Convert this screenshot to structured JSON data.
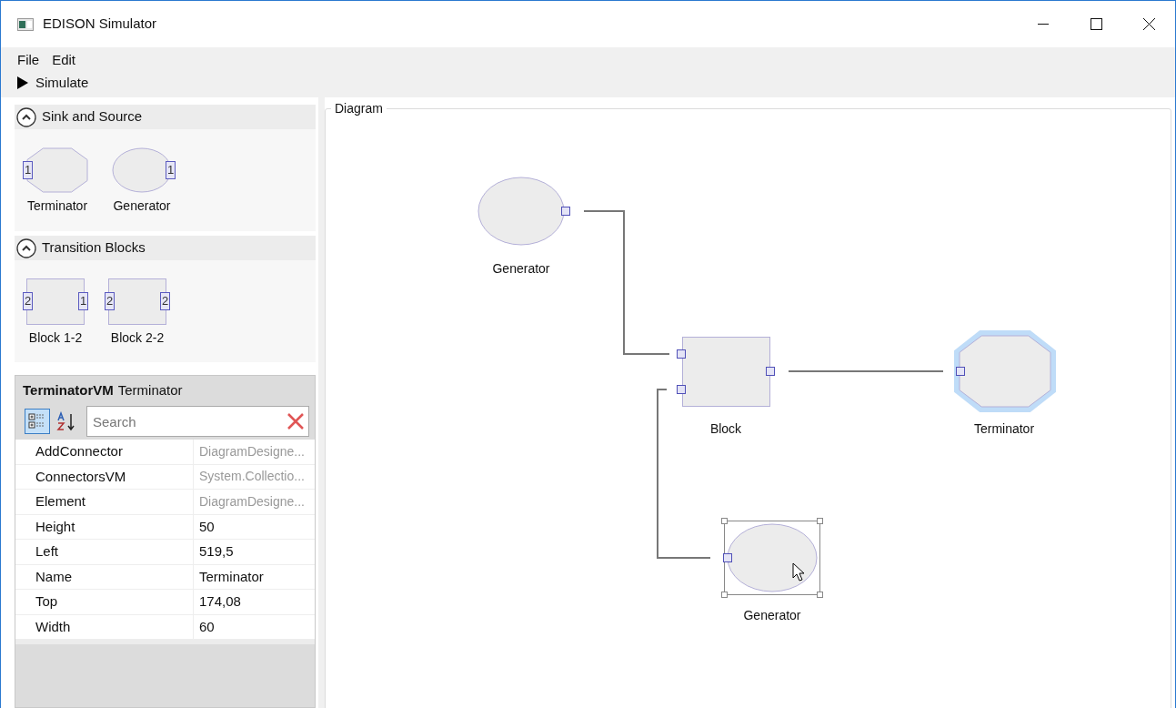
{
  "window": {
    "title": "EDISON Simulator"
  },
  "menu": [
    "File",
    "Edit"
  ],
  "toolbar": {
    "simulate": "Simulate"
  },
  "toolbox": [
    {
      "title": "Sink and Source",
      "expanded": true,
      "items": [
        {
          "kind": "octagon",
          "label": "Terminator",
          "left_ports": [
            "1"
          ]
        },
        {
          "kind": "ellipse",
          "label": "Generator",
          "right_ports": [
            "1"
          ]
        }
      ]
    },
    {
      "title": "Transition Blocks",
      "expanded": true,
      "items": [
        {
          "kind": "rect",
          "label": "Block 1-2",
          "left_ports": [
            "2"
          ],
          "right_ports": [
            "1"
          ]
        },
        {
          "kind": "rect",
          "label": "Block 2-2",
          "left_ports": [
            "2"
          ],
          "right_ports": [
            "2"
          ]
        }
      ]
    }
  ],
  "properties": {
    "type_name": "TerminatorVM",
    "object_name": "Terminator",
    "sort_buttons": [
      {
        "kind": "categorized",
        "selected": true
      },
      {
        "kind": "alphabetical",
        "selected": false
      }
    ],
    "search": {
      "placeholder": "Search"
    },
    "rows": [
      {
        "name": "AddConnector",
        "value": "DiagramDesigne...",
        "readonly": true
      },
      {
        "name": "ConnectorsVM",
        "value": "System.Collectio...",
        "readonly": true
      },
      {
        "name": "Element",
        "value": "DiagramDesigne...",
        "readonly": true
      },
      {
        "name": "Height",
        "value": "50",
        "readonly": false
      },
      {
        "name": "Left",
        "value": "519,5",
        "readonly": false
      },
      {
        "name": "Name",
        "value": "Terminator",
        "readonly": false
      },
      {
        "name": "Top",
        "value": "174,08",
        "readonly": false
      },
      {
        "name": "Width",
        "value": "60",
        "readonly": false
      }
    ]
  },
  "diagram": {
    "title": "Diagram",
    "nodes": [
      {
        "kind": "ellipse",
        "label": "Generator",
        "selected": false,
        "highlighted": false
      },
      {
        "kind": "rect",
        "label": "Block",
        "selected": false,
        "highlighted": false
      },
      {
        "kind": "octagon",
        "label": "Terminator",
        "selected": false,
        "highlighted": true
      },
      {
        "kind": "ellipse",
        "label": "Generator",
        "selected": true,
        "highlighted": false
      }
    ]
  }
}
